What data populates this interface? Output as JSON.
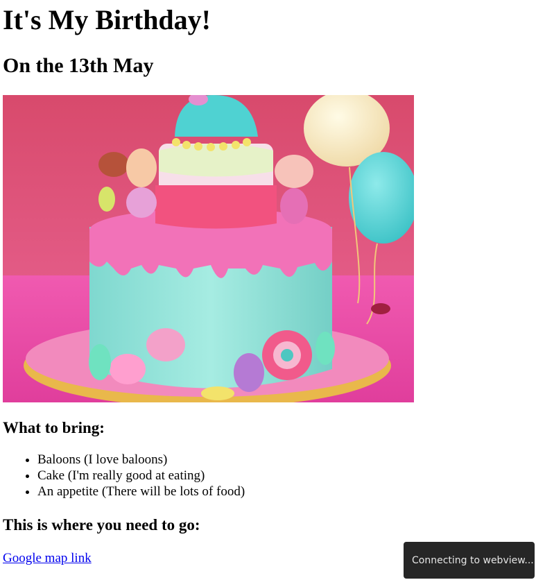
{
  "header": {
    "title": "It's My Birthday!",
    "subtitle": "On the 13th May"
  },
  "image": {
    "subject": "cake-photo"
  },
  "bring": {
    "heading": "What to bring:",
    "items": [
      "Baloons (I love baloons)",
      "Cake (I'm really good at eating)",
      "An appetite (There will be lots of food)"
    ]
  },
  "location": {
    "heading": "This is where you need to go:",
    "link_text": "Google map link"
  },
  "toast": {
    "text": "Connecting to webview..."
  },
  "colors": {
    "link": "#0000ee",
    "toast_bg": "#262626",
    "toast_text": "#e6e6e6"
  }
}
